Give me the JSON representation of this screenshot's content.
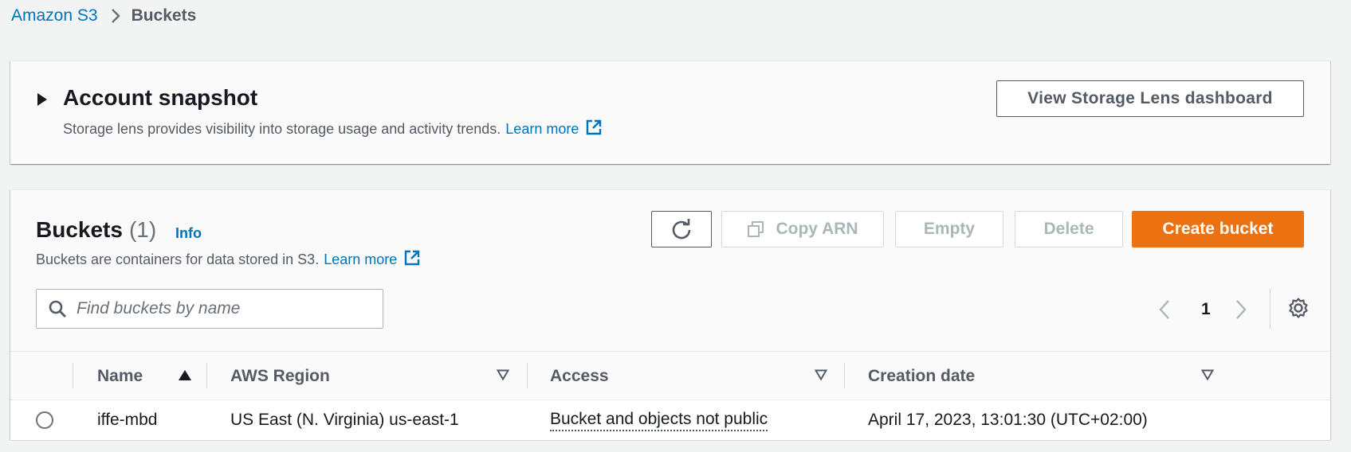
{
  "breadcrumb": {
    "root": "Amazon S3",
    "current": "Buckets"
  },
  "snapshot": {
    "title": "Account snapshot",
    "description": "Storage lens provides visibility into storage usage and activity trends.",
    "learn_more": "Learn more",
    "lens_button": "View Storage Lens dashboard"
  },
  "buckets": {
    "title": "Buckets",
    "count": "(1)",
    "info": "Info",
    "description": "Buckets are containers for data stored in S3.",
    "learn_more": "Learn more",
    "actions": {
      "copy_arn": "Copy ARN",
      "empty": "Empty",
      "delete": "Delete",
      "create": "Create bucket"
    },
    "search_placeholder": "Find buckets by name",
    "page": "1",
    "columns": {
      "name": "Name",
      "region": "AWS Region",
      "access": "Access",
      "created": "Creation date"
    },
    "rows": [
      {
        "name": "iffe-mbd",
        "region": "US East (N. Virginia) us-east-1",
        "access": "Bucket and objects not public",
        "created": "April 17, 2023, 13:01:30 (UTC+02:00)"
      }
    ]
  },
  "colors": {
    "accent": "#ec7211",
    "link": "#0073bb",
    "background": "#f2f3f3"
  },
  "icons": [
    "chevron-right-icon",
    "caret-right-icon",
    "external-link-icon",
    "refresh-icon",
    "copy-icon",
    "search-icon",
    "chevron-left-icon",
    "gear-icon",
    "sort-ascending-icon",
    "filter-down-icon"
  ]
}
